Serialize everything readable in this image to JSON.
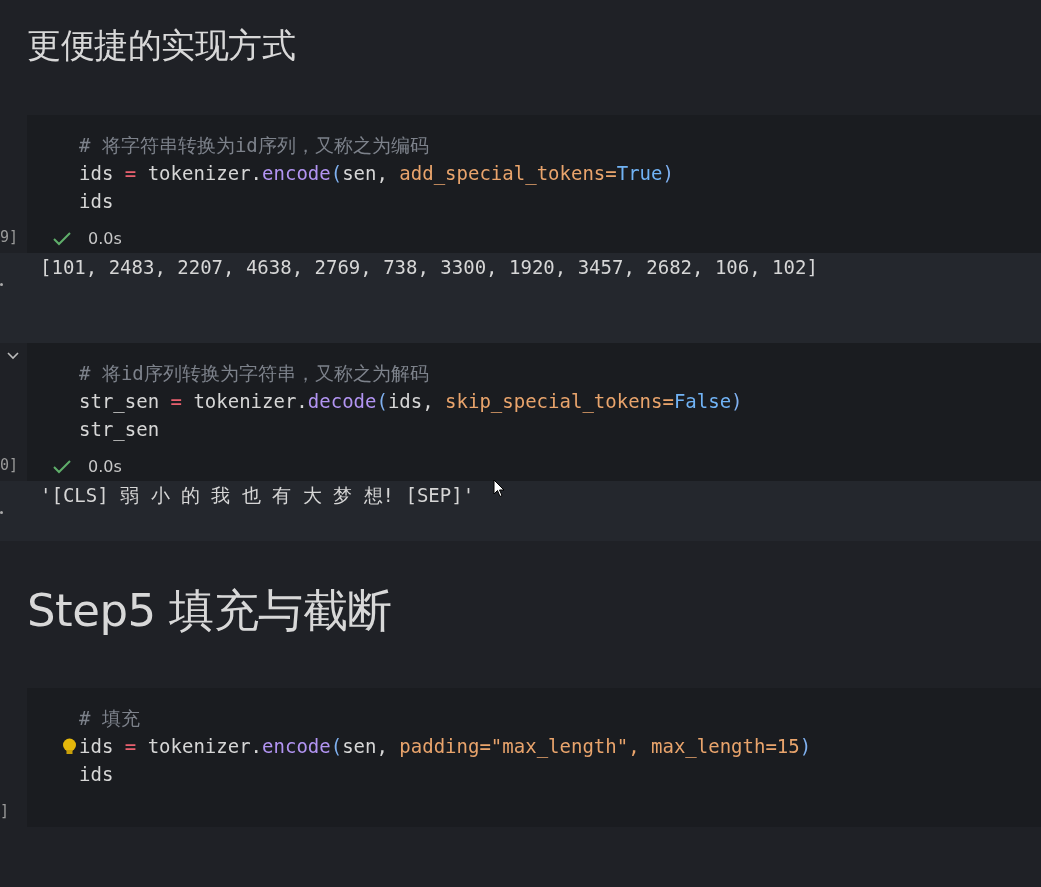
{
  "cells": [
    {
      "kind": "subheading",
      "text": "更便捷的实现方式"
    },
    {
      "kind": "code",
      "execution_count": "9]",
      "status": "0.0s",
      "succeeded": true,
      "lines": [
        [
          {
            "text": "# 将字符串转换为id序列，又称之为编码",
            "kind": "comment"
          }
        ],
        [
          {
            "text": "ids ",
            "kind": "plain"
          },
          {
            "text": "=",
            "kind": "operator"
          },
          {
            "text": " tokenizer.",
            "kind": "plain"
          },
          {
            "text": "encode",
            "kind": "function"
          },
          {
            "text": "(",
            "kind": "bracket"
          },
          {
            "text": "sen, ",
            "kind": "plain"
          },
          {
            "text": "add_special_tokens=",
            "kind": "param"
          },
          {
            "text": "True",
            "kind": "constant"
          },
          {
            "text": ")",
            "kind": "bracket"
          }
        ],
        [
          {
            "text": "ids",
            "kind": "plain"
          }
        ]
      ],
      "output": "[101, 2483, 2207, 4638, 2769, 738, 3300, 1920, 3457, 2682, 106, 102]"
    },
    {
      "kind": "code",
      "execution_count": "0]",
      "collapse_chevron": true,
      "status": "0.0s",
      "succeeded": true,
      "lines": [
        [
          {
            "text": "# 将id序列转换为字符串，又称之为解码",
            "kind": "comment"
          }
        ],
        [
          {
            "text": "str_sen ",
            "kind": "plain"
          },
          {
            "text": "=",
            "kind": "operator"
          },
          {
            "text": " tokenizer.",
            "kind": "plain"
          },
          {
            "text": "decode",
            "kind": "function"
          },
          {
            "text": "(",
            "kind": "bracket"
          },
          {
            "text": "ids, ",
            "kind": "plain"
          },
          {
            "text": "skip_special_tokens=",
            "kind": "param"
          },
          {
            "text": "False",
            "kind": "constant"
          },
          {
            "text": ")",
            "kind": "bracket"
          }
        ],
        [
          {
            "text": "str_sen",
            "kind": "plain"
          }
        ]
      ],
      "output": "'[CLS] 弱 小 的 我 也 有 大 梦 想! [SEP]'"
    },
    {
      "kind": "heading",
      "text": "Step5 填充与截断"
    },
    {
      "kind": "code",
      "execution_count": "]",
      "lightbulb": true,
      "lines": [
        [
          {
            "text": "# 填充",
            "kind": "comment"
          }
        ],
        [
          {
            "text": "ids ",
            "kind": "plain"
          },
          {
            "text": "=",
            "kind": "operator"
          },
          {
            "text": " tokenizer.",
            "kind": "plain"
          },
          {
            "text": "encode",
            "kind": "function"
          },
          {
            "text": "(",
            "kind": "bracket"
          },
          {
            "text": "sen, ",
            "kind": "plain"
          },
          {
            "text": "padding=\"max_length\", max_length=15",
            "kind": "param"
          },
          {
            "text": ")",
            "kind": "bracket"
          }
        ],
        [
          {
            "text": "ids",
            "kind": "plain"
          }
        ]
      ]
    }
  ]
}
